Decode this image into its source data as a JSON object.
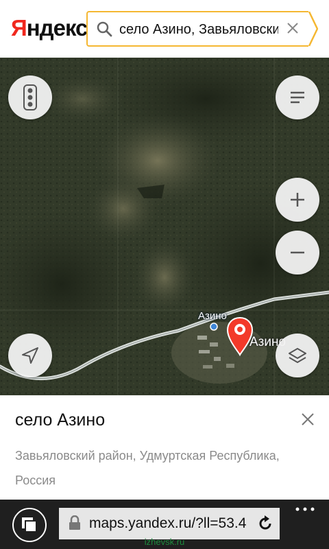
{
  "header": {
    "logo_first": "Я",
    "logo_rest": "ндекс",
    "search_value": "село Азино, Завьяловский район, Удмуртская Республика, Россия",
    "search_icon": "search-icon",
    "clear_icon": "close-icon"
  },
  "map": {
    "buttons": {
      "traffic": "traffic-light-icon",
      "menu": "menu-icon",
      "zoom_in": "plus-icon",
      "zoom_out": "minus-icon",
      "locate": "location-arrow-icon",
      "layers": "layers-icon"
    },
    "labels": {
      "village_small": "Азино",
      "village_big": "Азино"
    },
    "marker_color": "#f33a2a"
  },
  "card": {
    "title": "село Азино",
    "subtitle": "Завьяловский район, Удмуртская Республика, Россия",
    "close_icon": "close-icon"
  },
  "browser": {
    "url": "maps.yandex.ru/?ll=53.4",
    "lock_icon": "lock-icon",
    "refresh_icon": "refresh-icon",
    "tabs_icon": "tabs-icon",
    "more_icon": "more-dots-icon",
    "watermark": "izhevsk.ru"
  },
  "colors": {
    "accent": "#f5b731",
    "brand_red": "#f0281e"
  }
}
